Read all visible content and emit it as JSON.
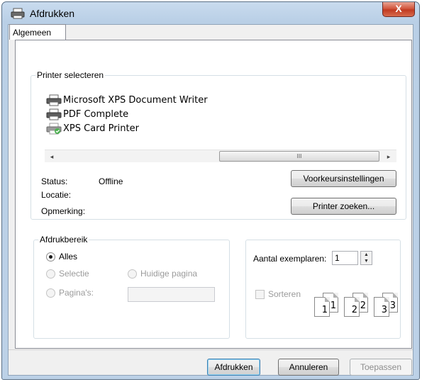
{
  "window": {
    "title": "Afdrukken",
    "close_glyph": "X",
    "title_icon": "printer-icon"
  },
  "tabs": [
    {
      "label": "Algemeen",
      "selected": true
    }
  ],
  "printer_group": {
    "label": "Printer selecteren",
    "printers": [
      {
        "name": "Microsoft XPS Document Writer",
        "icon": "printer-icon"
      },
      {
        "name": "PDF Complete",
        "icon": "printer-icon"
      },
      {
        "name": "XPS Card Printer",
        "icon": "printer-check-icon"
      }
    ],
    "scroll": {
      "left": "◂",
      "thumb": "III",
      "right": "▸"
    },
    "status_label": "Status:",
    "status_value": "Offline",
    "location_label": "Locatie:",
    "comment_label": "Opmerking:",
    "preferences_button": "Voorkeursinstellingen",
    "find_button": "Printer zoeken..."
  },
  "range_group": {
    "label": "Afdrukbereik",
    "all": "Alles",
    "selection": "Selectie",
    "current_page": "Huidige pagina",
    "pages": "Pagina's:"
  },
  "copies_group": {
    "copies_label": "Aantal exemplaren:",
    "copies_value": "1",
    "collate_label": "Sorteren",
    "collate_pages": [
      "1",
      "1",
      "2",
      "2",
      "3",
      "3"
    ]
  },
  "buttons": {
    "print": "Afdrukken",
    "cancel": "Annuleren",
    "apply": "Toepassen"
  }
}
